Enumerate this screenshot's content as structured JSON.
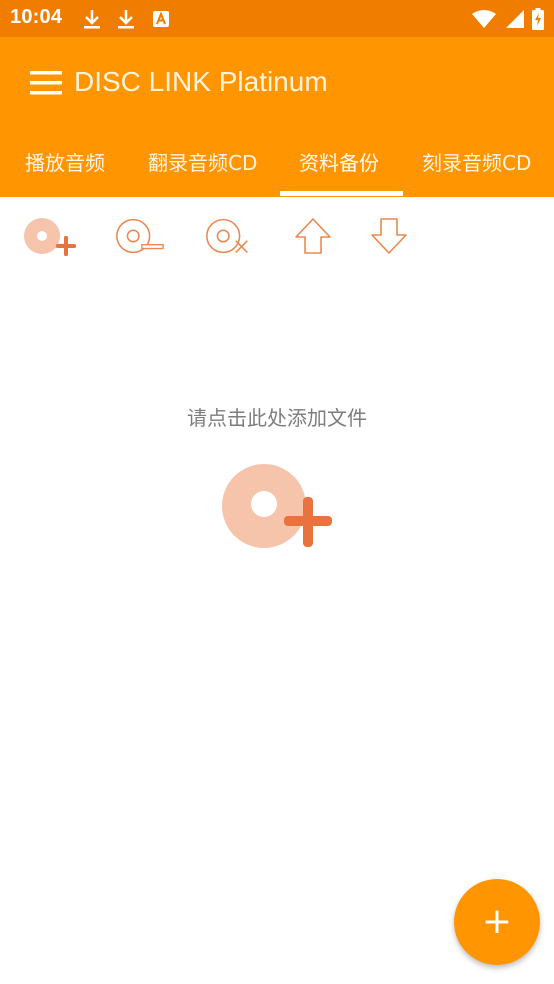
{
  "status_bar": {
    "time": "10:04",
    "left_icons": [
      "download-icon",
      "download-icon",
      "text-a-icon"
    ],
    "right_icons": [
      "wifi-icon",
      "signal-icon",
      "battery-icon"
    ]
  },
  "app_bar": {
    "title": "DISC LINK Platinum",
    "menu_icon": "hamburger-menu-icon",
    "colors": {
      "status": "#f07d00",
      "bar": "#ff9500"
    }
  },
  "tabs": [
    {
      "label": "播放音频",
      "active": false
    },
    {
      "label": "翻录音频CD",
      "active": false
    },
    {
      "label": "资料备份",
      "active": true
    },
    {
      "label": "刻录音频CD",
      "active": false
    }
  ],
  "toolbar": {
    "buttons": [
      "add-file-icon",
      "remove-file-icon",
      "delete-all-icon",
      "move-up-icon",
      "move-down-icon"
    ]
  },
  "main": {
    "hint": "请点击此处添加文件"
  },
  "fab": {
    "label": "+"
  }
}
